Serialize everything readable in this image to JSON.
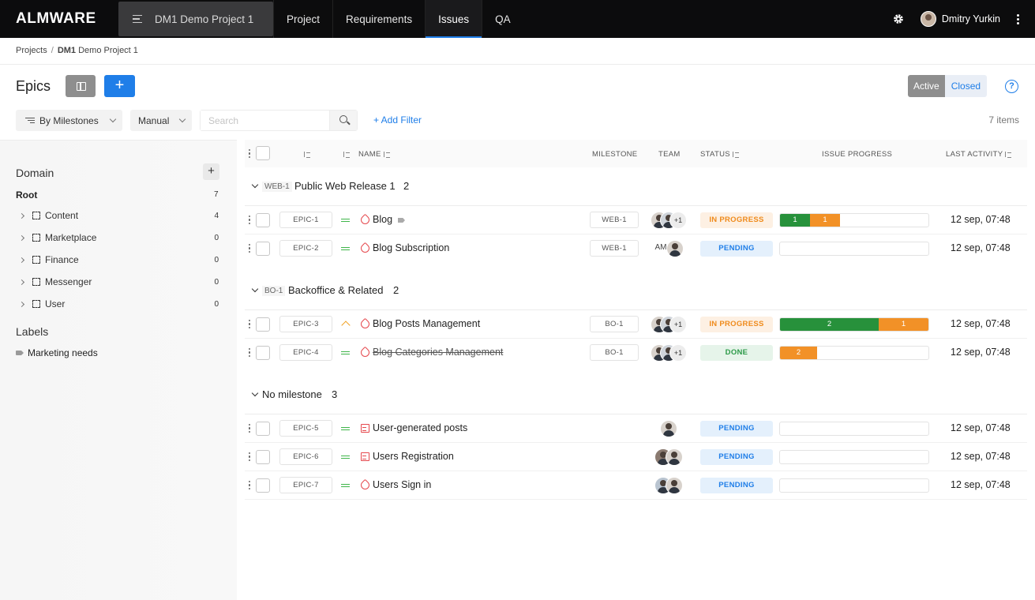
{
  "app": {
    "logo": "ALMWARE",
    "project_tab": "DM1 Demo Project 1",
    "nav": [
      "Project",
      "Requirements",
      "Issues",
      "QA"
    ],
    "active_nav": "Issues",
    "user_name": "Dmitry Yurkin"
  },
  "breadcrumb": {
    "root": "Projects",
    "sep": "/",
    "project_code": "DM1",
    "project_name": "Demo Project 1"
  },
  "page": {
    "title": "Epics",
    "add_label": "+",
    "seg_active": "Active",
    "seg_closed": "Closed",
    "help": "?",
    "filter_group": "By Milestones",
    "filter_sort": "Manual",
    "search_placeholder": "Search",
    "add_filter": "+ Add Filter",
    "items_count": "7 items"
  },
  "sidebar": {
    "domain_title": "Domain",
    "add": "+",
    "root_label": "Root",
    "root_count": "7",
    "items": [
      {
        "label": "Content",
        "count": "4"
      },
      {
        "label": "Marketplace",
        "count": "0"
      },
      {
        "label": "Finance",
        "count": "0"
      },
      {
        "label": "Messenger",
        "count": "0"
      },
      {
        "label": "User",
        "count": "0"
      }
    ],
    "labels_title": "Labels",
    "label_item": "Marketing needs"
  },
  "table": {
    "headers": {
      "name": "NAME",
      "milestone": "MILESTONE",
      "team": "TEAM",
      "status": "STATUS",
      "progress": "ISSUE PROGRESS",
      "activity": "LAST ACTIVITY"
    },
    "groups": [
      {
        "code": "WEB-1",
        "name": "Public Web Release 1",
        "count": "2"
      },
      {
        "code": "BO-1",
        "name": "Backoffice & Related",
        "count": "2"
      },
      {
        "code": "",
        "name": "No milestone",
        "count": "3"
      }
    ],
    "rows": [
      {
        "id": "EPIC-1",
        "name": "Blog",
        "milestone": "WEB-1",
        "team_more": "+1",
        "status": "IN PROGRESS",
        "p1": "1",
        "p2": "1",
        "activity": "12 sep, 07:48"
      },
      {
        "id": "EPIC-2",
        "name": "Blog Subscription",
        "milestone": "WEB-1",
        "team_initials": "AM",
        "status": "PENDING",
        "activity": "12 sep, 07:48"
      },
      {
        "id": "EPIC-3",
        "name": "Blog Posts Management",
        "milestone": "BO-1",
        "team_more": "+1",
        "status": "IN PROGRESS",
        "p1": "2",
        "p2": "1",
        "activity": "12 sep, 07:48"
      },
      {
        "id": "EPIC-4",
        "name": "Blog Categories Management",
        "milestone": "BO-1",
        "team_more": "+1",
        "status": "DONE",
        "p2": "2",
        "activity": "12 sep, 07:48"
      },
      {
        "id": "EPIC-5",
        "name": "User-generated posts",
        "status": "PENDING",
        "activity": "12 sep, 07:48"
      },
      {
        "id": "EPIC-6",
        "name": "Users Registration",
        "status": "PENDING",
        "activity": "12 sep, 07:48"
      },
      {
        "id": "EPIC-7",
        "name": "Users Sign in",
        "status": "PENDING",
        "activity": "12 sep, 07:48"
      }
    ],
    "progress_fractions": {
      "EPIC-1": {
        "green": 0.2,
        "orange": 0.2
      },
      "EPIC-3": {
        "green": 0.667,
        "orange": 0.333
      },
      "EPIC-4": {
        "green": 0,
        "orange": 0.25
      }
    }
  },
  "colors": {
    "accent": "#1f7ee8",
    "done_green": "#27913b",
    "progress_orange": "#f29127",
    "epic_red": "#e5484d"
  }
}
